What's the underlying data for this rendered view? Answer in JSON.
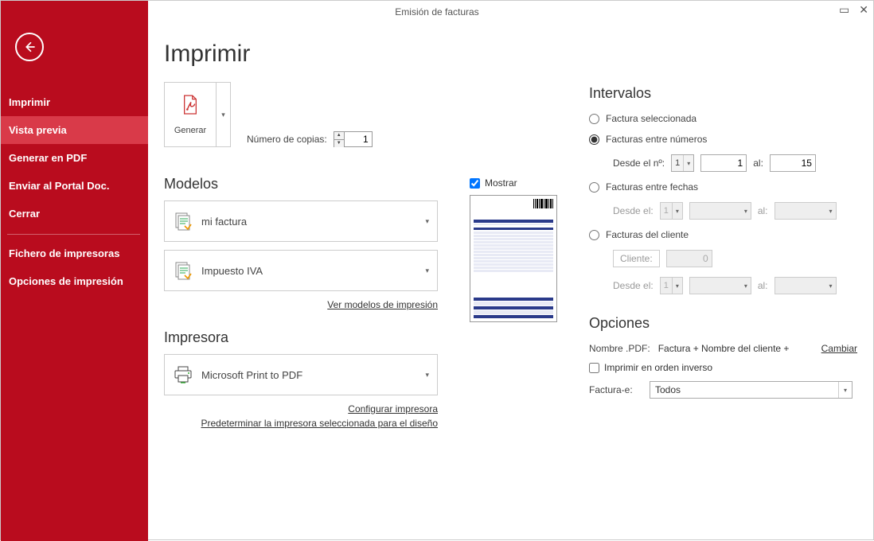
{
  "window": {
    "title": "Emisión de facturas"
  },
  "sidebar": {
    "items": [
      {
        "label": "Imprimir"
      },
      {
        "label": "Vista previa"
      },
      {
        "label": "Generar en PDF"
      },
      {
        "label": "Enviar al Portal Doc."
      },
      {
        "label": "Cerrar"
      },
      {
        "label": "Fichero de impresoras"
      },
      {
        "label": "Opciones de impresión"
      }
    ],
    "active_index": 1
  },
  "page": {
    "title": "Imprimir"
  },
  "generate_button": {
    "label": "Generar"
  },
  "copies": {
    "label": "Número de copias:",
    "value": "1"
  },
  "modelos": {
    "heading": "Modelos",
    "items": [
      {
        "label": "mi factura"
      },
      {
        "label": "Impuesto IVA"
      }
    ],
    "link": "Ver modelos de impresión"
  },
  "impresora": {
    "heading": "Impresora",
    "selected": "Microsoft Print to PDF",
    "configure_link": "Configurar impresora",
    "default_link": "Predeterminar la impresora seleccionada para el diseño"
  },
  "preview": {
    "mostrar_label": "Mostrar",
    "mostrar_checked": true
  },
  "intervalos": {
    "heading": "Intervalos",
    "options": {
      "seleccionada": "Factura seleccionada",
      "entre_numeros": "Facturas entre números",
      "entre_fechas": "Facturas entre fechas",
      "del_cliente": "Facturas del cliente"
    },
    "selected": "entre_numeros",
    "desde_num_label": "Desde el nº:",
    "desde_num_serie": "1",
    "desde_num_value": "1",
    "al_label": "al:",
    "hasta_num_value": "15",
    "desde_fecha_label": "Desde el:",
    "fecha_serie": "1",
    "cliente_label": "Cliente:",
    "cliente_value": "0"
  },
  "opciones": {
    "heading": "Opciones",
    "nombre_pdf_label": "Nombre .PDF:",
    "nombre_pdf_value": "Factura + Nombre del cliente +",
    "cambiar": "Cambiar",
    "orden_inverso": "Imprimir en orden inverso",
    "facturae_label": "Factura-e:",
    "facturae_value": "Todos"
  }
}
